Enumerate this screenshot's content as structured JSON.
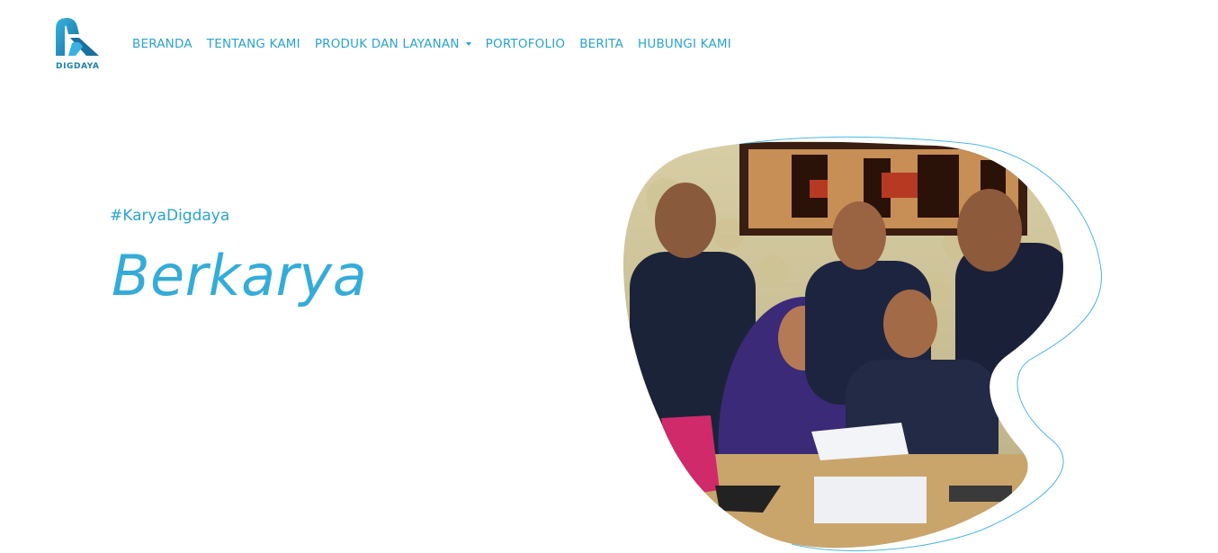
{
  "brand": {
    "name": "DIGDAYA",
    "logo_icon": "digdaya-logo-icon",
    "color": "#1b7fa8"
  },
  "nav": {
    "items": [
      {
        "label": "BERANDA"
      },
      {
        "label": "TENTANG KAMI"
      },
      {
        "label": "PRODUK DAN LAYANAN",
        "has_dropdown": true
      },
      {
        "label": "PORTOFOLIO"
      },
      {
        "label": "BERITA"
      },
      {
        "label": "HUBUNGI KAMI"
      }
    ],
    "color": "#2aa3cf"
  },
  "hero": {
    "hashtag": "#KaryaDigdaya",
    "headline": "Berkarya",
    "accent": "#35acd8",
    "photo": "team-photo-blob"
  }
}
